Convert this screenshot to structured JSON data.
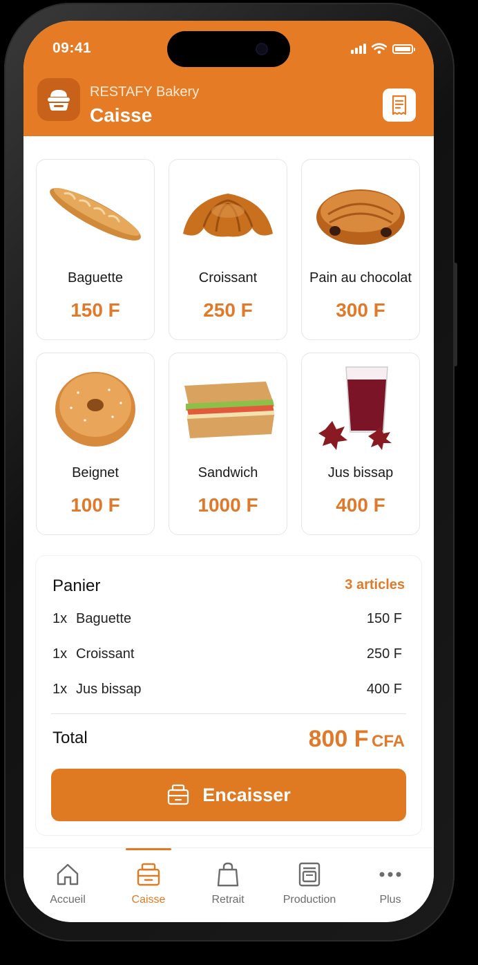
{
  "status": {
    "time": "09:41"
  },
  "header": {
    "brand": "RESTAFY Bakery",
    "title": "Caisse"
  },
  "products": [
    {
      "name": "Baguette",
      "price": "150 F",
      "icon": "baguette-icon"
    },
    {
      "name": "Croissant",
      "price": "250 F",
      "icon": "croissant-icon"
    },
    {
      "name": "Pain au chocolat",
      "price": "300 F",
      "icon": "pain-au-chocolat-icon"
    },
    {
      "name": "Beignet",
      "price": "100 F",
      "icon": "donut-icon"
    },
    {
      "name": "Sandwich",
      "price": "1000 F",
      "icon": "sandwich-icon"
    },
    {
      "name": "Jus bissap",
      "price": "400 F",
      "icon": "juice-icon"
    }
  ],
  "cart": {
    "title": "Panier",
    "count": "3 articles",
    "items": [
      {
        "qty": "1x",
        "name": "Baguette",
        "amount": "150 F"
      },
      {
        "qty": "1x",
        "name": "Croissant",
        "amount": "250 F"
      },
      {
        "qty": "1x",
        "name": "Jus bissap",
        "amount": "400 F"
      }
    ],
    "total_label": "Total",
    "total_value": "800 F",
    "total_currency": "CFA",
    "checkout_label": "Encaisser"
  },
  "tabs": [
    {
      "label": "Accueil",
      "icon": "home-icon"
    },
    {
      "label": "Caisse",
      "icon": "cash-register-icon",
      "active": true
    },
    {
      "label": "Retrait",
      "icon": "shopping-bag-icon"
    },
    {
      "label": "Production",
      "icon": "oven-icon"
    },
    {
      "label": "Plus",
      "icon": "more-icon"
    }
  ],
  "colors": {
    "accent": "#E57C25",
    "price": "#E07A2A",
    "background": "#FFFFFF"
  }
}
